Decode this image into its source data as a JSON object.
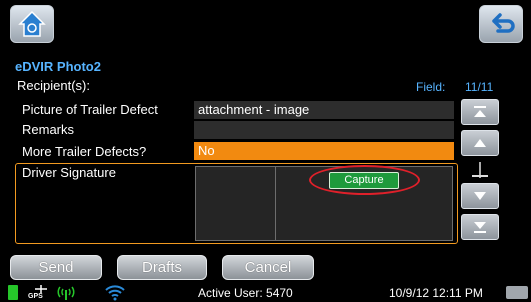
{
  "header": {
    "title": "eDVIR Photo2",
    "recipients_label": "Recipient(s):",
    "field_label": "Field:",
    "field_value": "11/11"
  },
  "form": {
    "rows": [
      {
        "label": "Picture of Trailer Defect",
        "value": "attachment - image"
      },
      {
        "label": "Remarks",
        "value": ""
      },
      {
        "label": "More Trailer Defects?",
        "value": "No"
      }
    ],
    "signature_label": "Driver Signature",
    "capture_label": "Capture"
  },
  "buttons": {
    "send": "Send",
    "drafts": "Drafts",
    "cancel": "Cancel"
  },
  "status": {
    "gps_label": "GPS",
    "active_user": "Active User: 5470",
    "datetime": "10/9/12 12:11 PM"
  },
  "colors": {
    "accent_blue": "#57b4ff",
    "highlight_orange": "#f28a10",
    "capture_green": "#1e9a3c",
    "annotation_red": "#e0202a"
  },
  "icons": {
    "home": "home-icon",
    "back": "back-arrow-icon",
    "scroll_top": "scroll-to-top-icon",
    "scroll_up": "scroll-up-icon",
    "scroll_down": "scroll-down-icon",
    "scroll_bottom": "scroll-to-bottom-icon",
    "battery": "battery-icon",
    "gps": "gps-icon",
    "signal": "signal-icon",
    "wifi": "wifi-icon",
    "keyboard": "keyboard-icon"
  }
}
